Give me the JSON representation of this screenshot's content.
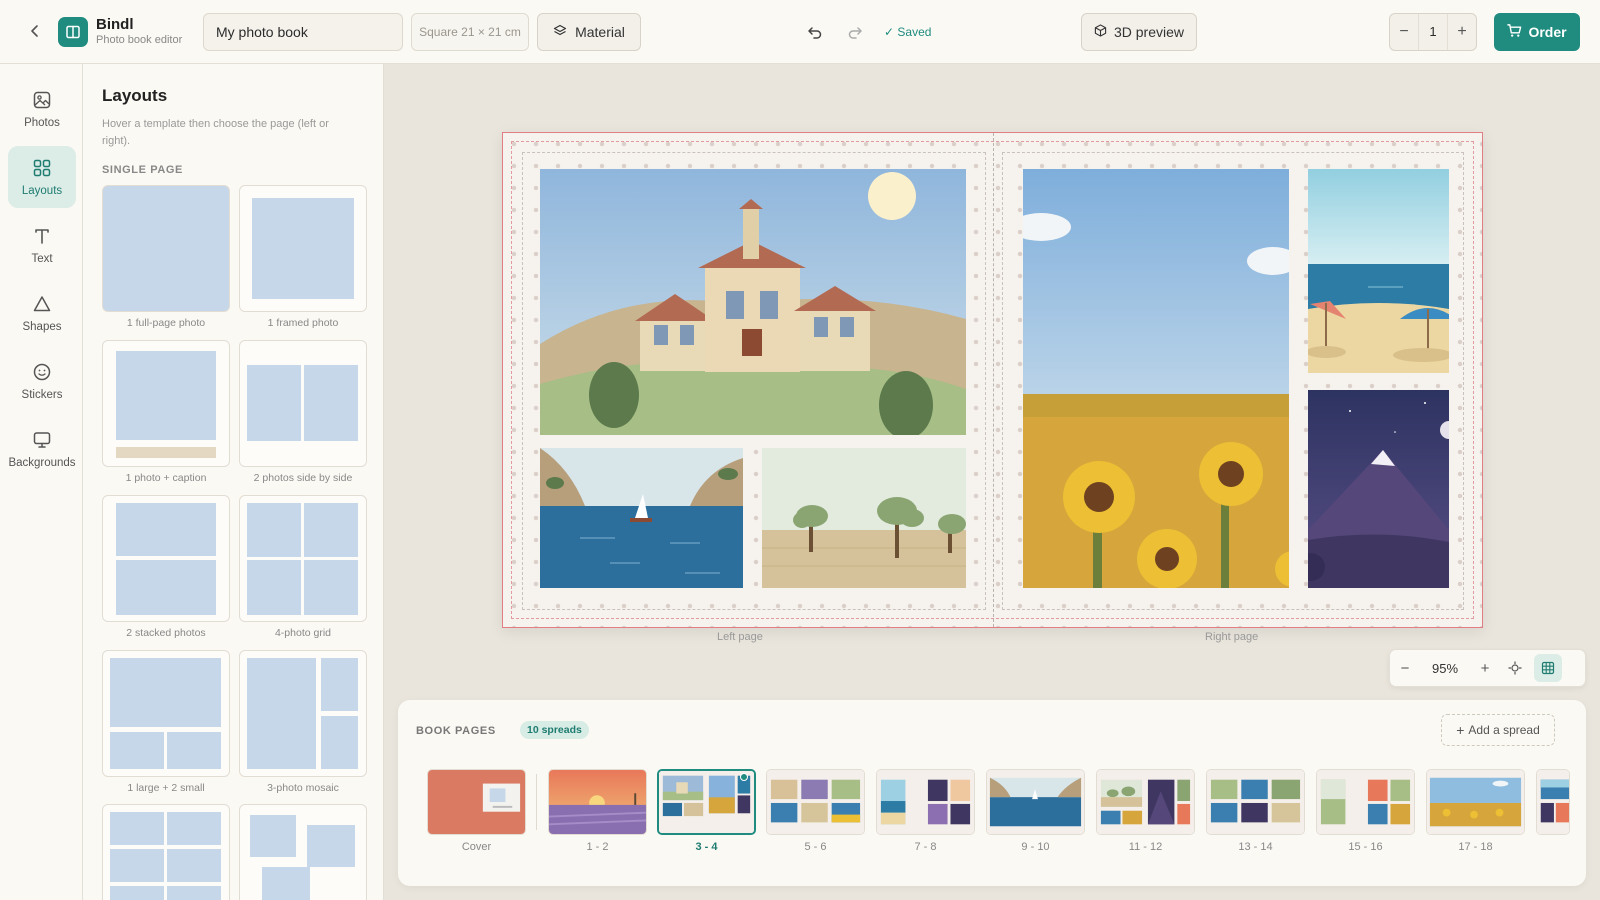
{
  "app": {
    "name": "Bindl",
    "subtitle": "Photo book editor"
  },
  "header": {
    "book_title": "My photo book",
    "size": "Square 21 × 21 cm",
    "material_label": "Material",
    "saved_label": "✓ Saved",
    "preview_label": "3D preview",
    "quantity": "1",
    "qty_minus": "−",
    "qty_plus": "+",
    "order_label": "Order"
  },
  "rail": {
    "items": [
      {
        "label": "Photos",
        "icon": "photo-icon"
      },
      {
        "label": "Layouts",
        "icon": "grid-icon",
        "active": true
      },
      {
        "label": "Text",
        "icon": "text-icon"
      },
      {
        "label": "Shapes",
        "icon": "triangle-icon"
      },
      {
        "label": "Stickers",
        "icon": "smiley-icon"
      },
      {
        "label": "Backgrounds",
        "icon": "monitor-icon"
      }
    ]
  },
  "layouts_panel": {
    "title": "Layouts",
    "hint": "Hover a template then choose the page (left or right).",
    "section": "SINGLE PAGE",
    "templates": [
      "1 full-page photo",
      "1 framed photo",
      "1 photo + caption",
      "2 photos side by side",
      "2 stacked photos",
      "4-photo grid",
      "1 large + 2 small",
      "3-photo mosaic"
    ]
  },
  "canvas": {
    "left_page_label": "Left page",
    "right_page_label": "Right page",
    "zoom": "95%",
    "zoom_minus": "−",
    "zoom_plus": "+"
  },
  "book_pages": {
    "title": "BOOK PAGES",
    "count_badge": "10 spreads",
    "add_label": "Add a spread",
    "thumbs": [
      "Cover",
      "1 - 2",
      "3 - 4",
      "5 - 6",
      "7 - 8",
      "9 - 10",
      "11 - 12",
      "13 - 14",
      "15 - 16",
      "17 - 18"
    ],
    "active_index": 2
  },
  "colors": {
    "accent": "#1f8c7f",
    "accent_soft": "#dcece7",
    "placeholder_blue": "#c6d7e9",
    "spread_border": "#e07d85"
  }
}
